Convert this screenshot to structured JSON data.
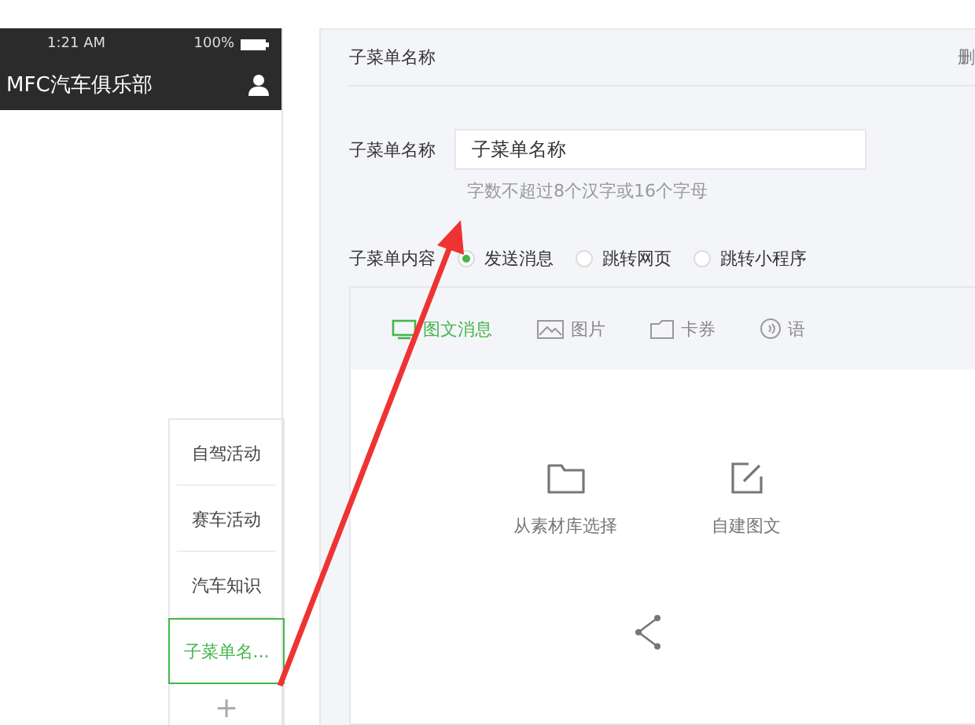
{
  "phone": {
    "status_time": "1:21 AM",
    "battery": "100%",
    "title": "MFC汽车俱乐部"
  },
  "submenu": {
    "items": [
      {
        "label": "自驾活动",
        "selected": false
      },
      {
        "label": "赛车活动",
        "selected": false
      },
      {
        "label": "汽车知识",
        "selected": false
      },
      {
        "label": "子菜单名...",
        "selected": true
      }
    ],
    "add": "+"
  },
  "editor": {
    "header": "子菜单名称",
    "delete": "删",
    "name_label": "子菜单名称",
    "name_value": "子菜单名称",
    "hint": "字数不超过8个汉字或16个字母",
    "content_label": "子菜单内容",
    "options": [
      {
        "label": "发送消息",
        "selected": true
      },
      {
        "label": "跳转网页",
        "selected": false
      },
      {
        "label": "跳转小程序",
        "selected": false
      }
    ],
    "tabs": [
      {
        "kind": "news",
        "label": "图文消息",
        "selected": true
      },
      {
        "kind": "image",
        "label": "图片",
        "selected": false
      },
      {
        "kind": "card",
        "label": "卡券",
        "selected": false
      },
      {
        "kind": "voice",
        "label": "语",
        "selected": false
      }
    ],
    "actions": [
      {
        "kind": "library",
        "label": "从素材库选择"
      },
      {
        "kind": "create",
        "label": "自建图文"
      }
    ]
  }
}
